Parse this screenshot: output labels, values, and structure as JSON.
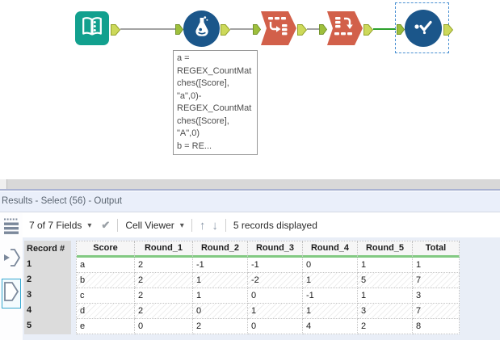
{
  "colors": {
    "tool_teal": "#12a08e",
    "tool_blue": "#1b568a",
    "tool_orange": "#d2604a",
    "anchor_green": "#cdd95a",
    "anchor_green_dark": "#9ebf3c",
    "connection_grey": "#a3a3a3",
    "connection_selected_green": "#2ca02c",
    "selection_border_blue": "#4a90d2",
    "header_underline_green": "#82c982"
  },
  "canvas": {
    "annotation": "a =\nREGEX_CountMat\nches([Score],\n\"a\",0)-\nREGEX_CountMat\nches([Score],\n\"A\",0)\nb = RE..."
  },
  "results": {
    "title": "Results - Select (56) - Output",
    "toolbar": {
      "fields_label": "7 of 7 Fields",
      "cell_viewer_label": "Cell Viewer",
      "records_label": "5 records displayed"
    },
    "icons": {
      "caret_down": "▾",
      "check": "✔",
      "arrow_up": "↑",
      "arrow_down": "↓"
    },
    "table": {
      "record_header": "Record #",
      "columns": [
        "Score",
        "Round_1",
        "Round_2",
        "Round_3",
        "Round_4",
        "Round_5",
        "Total"
      ],
      "rows": [
        {
          "record": "1",
          "cells": [
            "a",
            "2",
            "-1",
            "-1",
            "0",
            "1",
            "1"
          ]
        },
        {
          "record": "2",
          "cells": [
            "b",
            "2",
            "1",
            "-2",
            "1",
            "5",
            "7"
          ]
        },
        {
          "record": "3",
          "cells": [
            "c",
            "2",
            "1",
            "0",
            "-1",
            "1",
            "3"
          ]
        },
        {
          "record": "4",
          "cells": [
            "d",
            "2",
            "0",
            "1",
            "1",
            "3",
            "7"
          ]
        },
        {
          "record": "5",
          "cells": [
            "e",
            "0",
            "2",
            "0",
            "4",
            "2",
            "8"
          ]
        }
      ]
    }
  }
}
